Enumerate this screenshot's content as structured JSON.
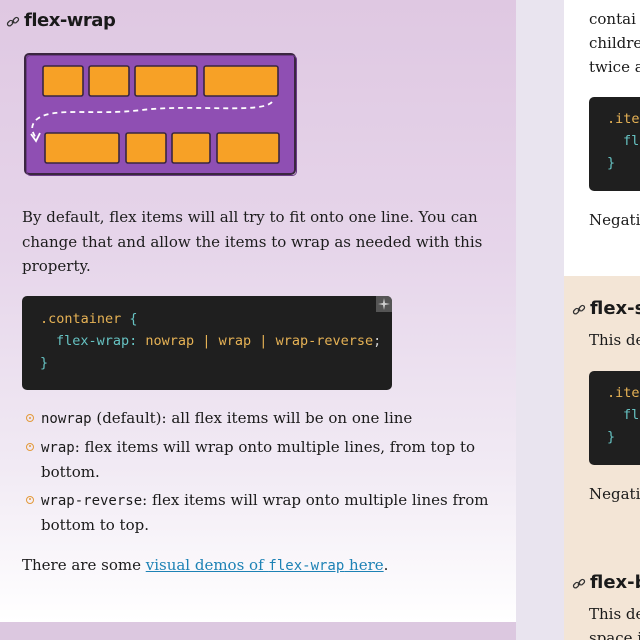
{
  "section": {
    "title": "flex-wrap",
    "link_icon": "link-icon",
    "intro": "By default, flex items will all try to fit onto one line. You can change that and allow the items to wrap as needed with this property.",
    "code": {
      "selector": ".container",
      "open_brace": "{",
      "property": "flex-wrap:",
      "values": [
        "nowrap",
        "|",
        "wrap",
        "|",
        "wrap-reverse",
        ";"
      ],
      "close_brace": "}"
    },
    "bullets": [
      {
        "code": "nowrap",
        "text": " (default): all flex items will be on one line"
      },
      {
        "code": "wrap",
        "text": ": flex items will wrap onto multiple lines, from top to bottom."
      },
      {
        "code": "wrap-reverse",
        "text": ": flex items will wrap onto multiple lines from bottom to top."
      }
    ],
    "outro_prefix": "There are some ",
    "outro_link_text": "visual demos of ",
    "outro_link_code": "flex-wrap",
    "outro_link_suffix": " here",
    "outro_suffix": "."
  },
  "right": {
    "card1": {
      "lines": [
        "contai",
        "childre",
        "twice a"
      ],
      "code": [
        ".ite",
        "fle",
        "}"
      ],
      "after": "Negativ"
    },
    "card2": {
      "title": "flex-sh",
      "line": "This de",
      "code": [
        ".ite",
        "fle",
        "}"
      ],
      "after": "Negativ"
    },
    "card3": {
      "title": "flex-b",
      "lines": [
        "This de",
        "space i"
      ]
    }
  },
  "colors": {
    "accent_orange": "#e39a3b",
    "code_bg": "#1f1f1f",
    "link": "#1d82b5",
    "panel_purple": "#dfc8e2",
    "card_tan": "#f3e5d6"
  }
}
